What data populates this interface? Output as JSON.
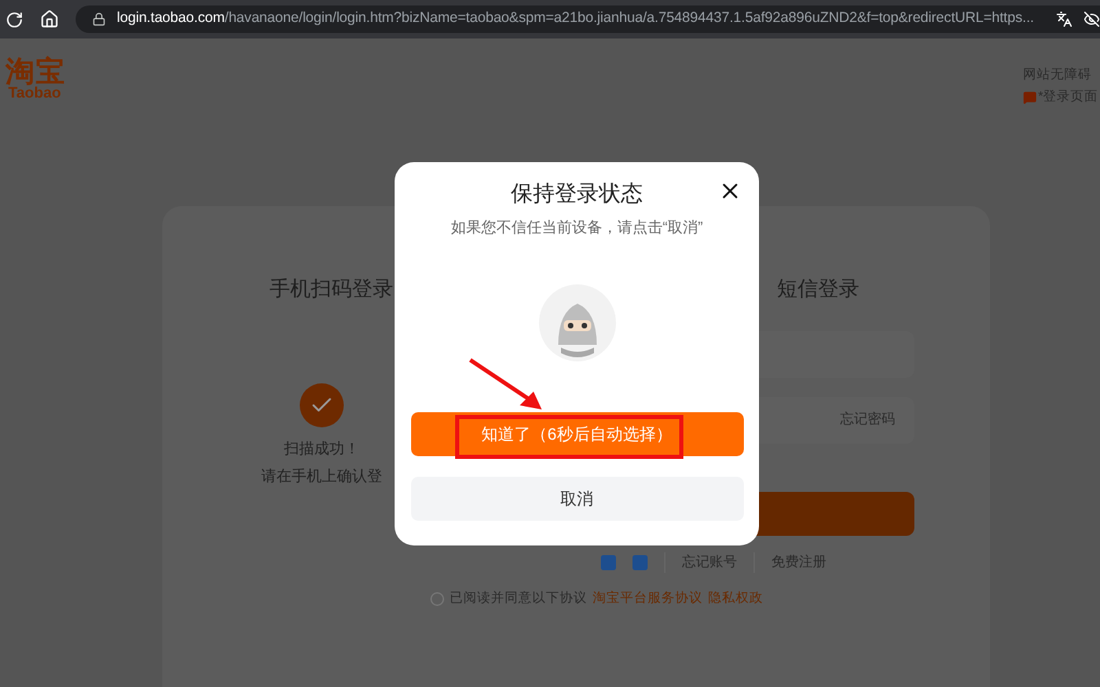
{
  "browser": {
    "url_host": "login.taobao.com",
    "url_path": "/havanaone/login/login.htm?bizName=taobao&spm=a21bo.jianhua/a.754894437.1.5af92a896uZND2&f=top&redirectURL=https..."
  },
  "header": {
    "logo_cn": "淘宝",
    "logo_en": "Taobao",
    "accessibility": "网站无障碍",
    "feedback": "*登录页面"
  },
  "login_card": {
    "qr": {
      "title": "手机扫码登录",
      "status": "扫描成功！",
      "hint": "请在手机上确认登"
    },
    "sms_tab": "短信登录",
    "forgot_password": "忘记密码",
    "links": [
      "忘记账号",
      "免费注册"
    ],
    "agreement": {
      "checked": false,
      "text": "已阅读并同意以下协议",
      "links": [
        "淘宝平台服务协议",
        "隐私权政"
      ]
    }
  },
  "dialog": {
    "title": "保持登录状态",
    "subtitle": "如果您不信任当前设备，请点击“取消”",
    "confirm": "知道了（6秒后自动选择）",
    "cancel": "取消"
  }
}
